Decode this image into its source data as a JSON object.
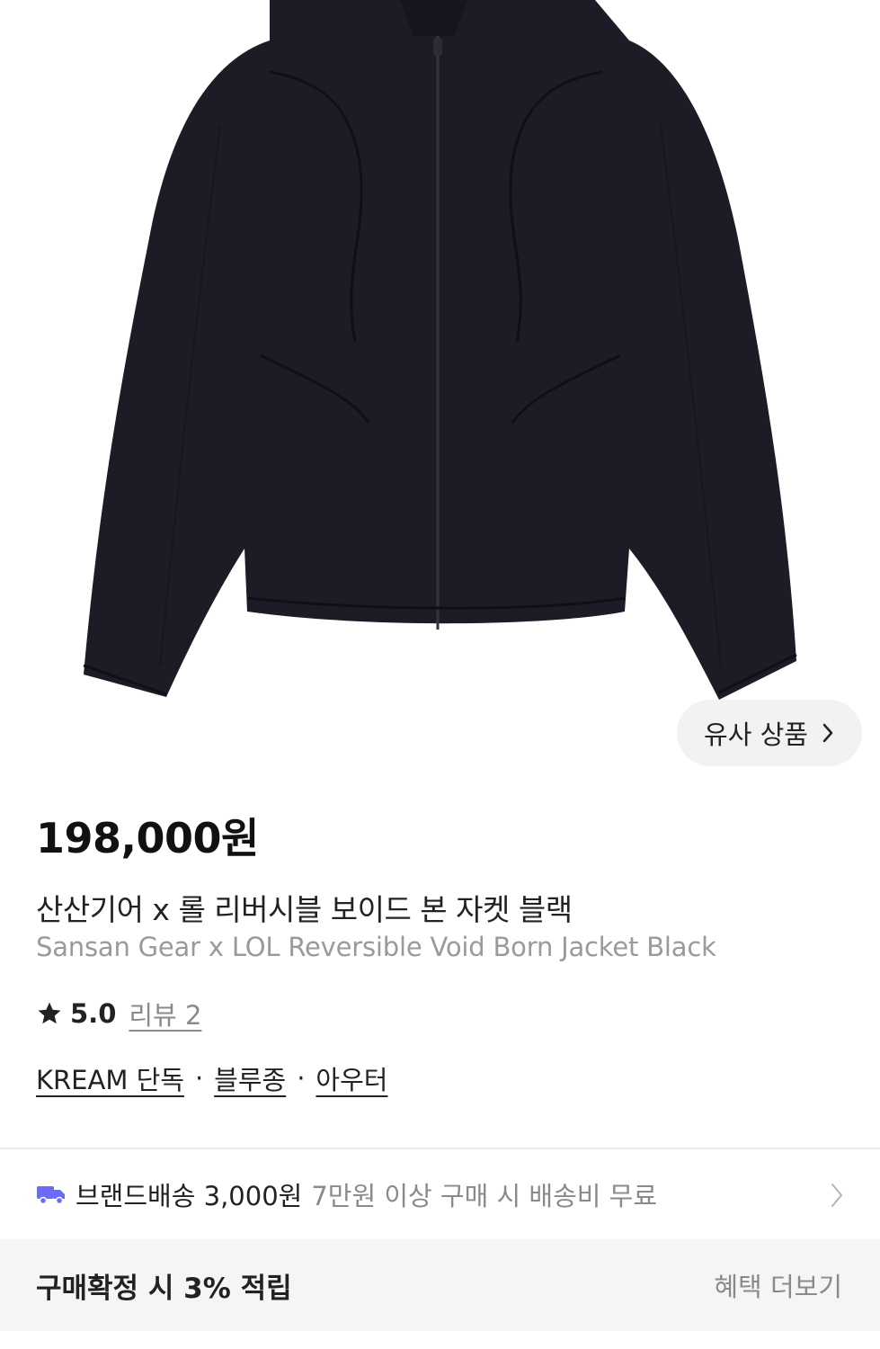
{
  "similar_button": {
    "label": "유사 상품",
    "icon": "chevron-right-icon"
  },
  "price": "198,000원",
  "product": {
    "name_ko": "산산기어 x 롤 리버시블 보이드 본 자켓 블랙",
    "name_en": "Sansan Gear x LOL Reversible Void Born Jacket Black"
  },
  "rating": {
    "icon": "star-icon",
    "score": "5.0",
    "review_label": "리뷰 2"
  },
  "tags": [
    "KREAM 단독",
    "블루종",
    "아우터"
  ],
  "tag_separator": "·",
  "shipping": {
    "icon": "truck-icon",
    "label": "브랜드배송 3,000원",
    "description": "7만원 이상 구매 시 배송비 무료",
    "icon_color": "#6b6bf5"
  },
  "benefit": {
    "title": "구매확정 시 3% 적립",
    "more_label": "혜택 더보기"
  },
  "colors": {
    "jacket": "#1b1c26",
    "background": "#ffffff",
    "accent": "#6b6bf5"
  }
}
